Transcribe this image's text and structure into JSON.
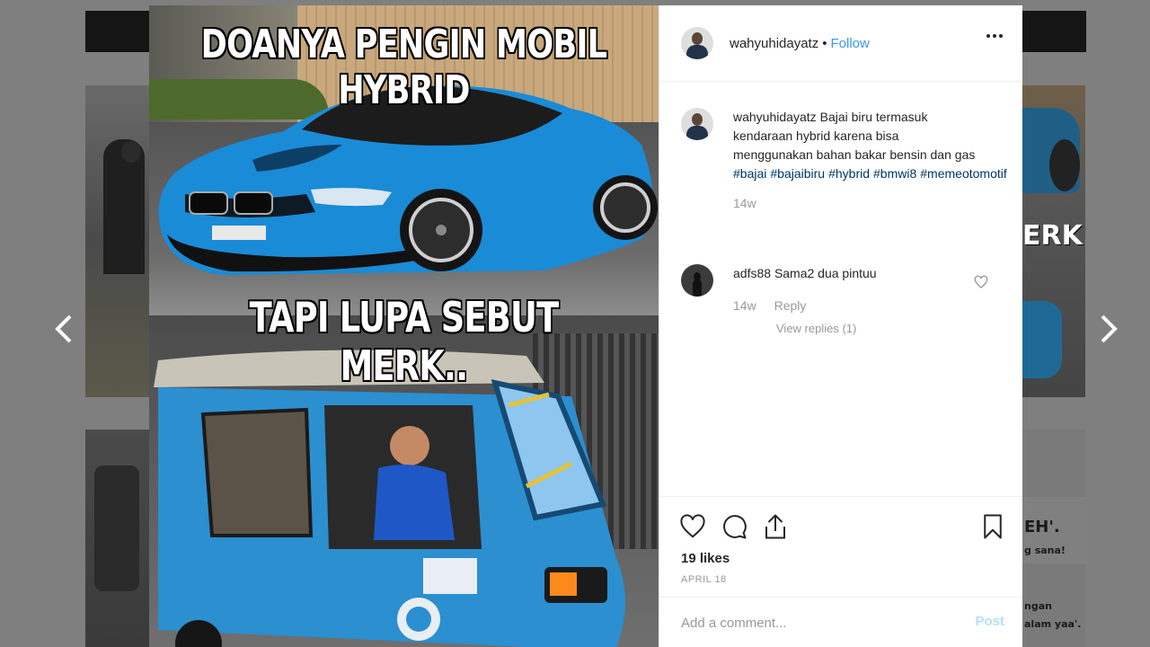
{
  "post": {
    "image_top_text": "DOANYA PENGIN MOBIL HYBRID",
    "image_mid_text": "TAPI LUPA SEBUT MERK..",
    "username": "wahyuhidayatz",
    "follow_label": "Follow",
    "separator": "•",
    "caption": {
      "username": "wahyuhidayatz",
      "text": "Bajai biru termasuk kendaraan hybrid karena bisa menggunakan bahan bakar bensin dan gas",
      "hashtags": [
        "#bajai",
        "#bajaibiru",
        "#hybrid",
        "#bmwi8",
        "#memeotomotif"
      ],
      "time": "14w"
    },
    "comments": [
      {
        "username": "adfs88",
        "text": "Sama2 dua pintuu",
        "time": "14w",
        "reply_label": "Reply",
        "view_replies": "View replies (1)"
      }
    ],
    "likes": "19 likes",
    "date": "APRIL 18",
    "comment_placeholder": "Add a comment...",
    "post_label": "Post"
  },
  "background": {
    "text_right_1": "EH'.",
    "text_right_2": "g sana!",
    "text_right_3": "ngan",
    "text_right_4": "alam yaa'.",
    "text_right_merk": "ERK.."
  },
  "icons": {
    "prev": "chevron-left-icon",
    "next": "chevron-right-icon",
    "like": "heart-icon",
    "comment": "comment-icon",
    "share": "share-icon",
    "save": "bookmark-icon",
    "more": "more-horizontal-icon"
  }
}
